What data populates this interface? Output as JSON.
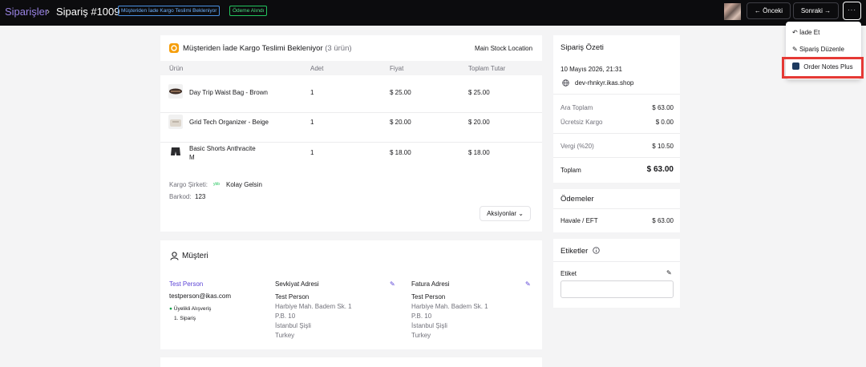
{
  "header": {
    "breadcrumb": "Siparişler",
    "title": "Sipariş #1009",
    "badge_status": "Müşteriden İade Kargo Teslimi Bekleniyor",
    "badge_payment": "Ödeme Alındı",
    "prev_label": "Önceki",
    "next_label": "Sonraki",
    "more_label": "···"
  },
  "dropdown": {
    "items": [
      {
        "label": "İade Et",
        "icon": "undo-icon"
      },
      {
        "label": "Sipariş Düzenle",
        "icon": "pencil-icon"
      },
      {
        "label": "Order Notes Plus",
        "icon": "app-icon"
      }
    ],
    "highlight_color": "#e53935"
  },
  "fulfillment": {
    "title": "Müşteriden İade Kargo Teslimi Bekleniyor",
    "count": "(3 ürün)",
    "location": "Main Stock Location",
    "columns": [
      "Ürün",
      "Adet",
      "Fiyat",
      "Toplam Tutar"
    ],
    "rows": [
      {
        "name": "Day Trip Waist Bag - Brown",
        "variant": "",
        "qty": "1",
        "price": "$ 25.00",
        "total": "$ 25.00"
      },
      {
        "name": "Grid Tech Organizer - Beige",
        "variant": "",
        "qty": "1",
        "price": "$ 20.00",
        "total": "$ 20.00"
      },
      {
        "name": "Basic Shorts Anthracite",
        "variant": "M",
        "qty": "1",
        "price": "$ 18.00",
        "total": "$ 18.00"
      }
    ],
    "cargo_label": "Kargo Şirketi:",
    "cargo_logo": "ybb",
    "cargo_value": "Kolay Gelsin",
    "barcode_label": "Barkod:",
    "barcode_value": "123",
    "actions_label": "Aksiyonlar"
  },
  "customer": {
    "title": "Müşteri",
    "name": "Test Person",
    "email": "testperson@ikas.com",
    "member_label": "Üyelikli Alışveriş",
    "order_count": "1. Sipariş",
    "shipping": {
      "title": "Sevkiyat Adresi",
      "lines": [
        "Test Person",
        "Harbiye Mah. Badem Sk. 1",
        "P.B. 10",
        "İstanbul Şişli",
        "Turkey"
      ]
    },
    "billing": {
      "title": "Fatura Adresi",
      "lines": [
        "Test Person",
        "Harbiye Mah. Badem Sk. 1",
        "P.B. 10",
        "İstanbul Şişli",
        "Turkey"
      ]
    }
  },
  "summary": {
    "title": "Sipariş Özeti",
    "date": "10 Mayıs 2026, 21:31",
    "store": "dev-rhnkyr.ikas.shop",
    "rows": [
      {
        "label": "Ara Toplam",
        "value": "$ 63.00"
      },
      {
        "label": "Ücretsiz Kargo",
        "value": "$ 0.00"
      },
      {
        "label": "Vergi (%20)",
        "value": "$ 10.50"
      }
    ],
    "total_label": "Toplam",
    "total_value": "$ 63.00"
  },
  "payments": {
    "title": "Ödemeler",
    "method": "Havale / EFT",
    "amount": "$ 63.00"
  },
  "tags": {
    "title": "Etiketler",
    "field_label": "Etiket"
  },
  "colors": {
    "accent": "#5b43d6",
    "topbar": "#0c0c0e",
    "member_dot": "#16a34a"
  }
}
